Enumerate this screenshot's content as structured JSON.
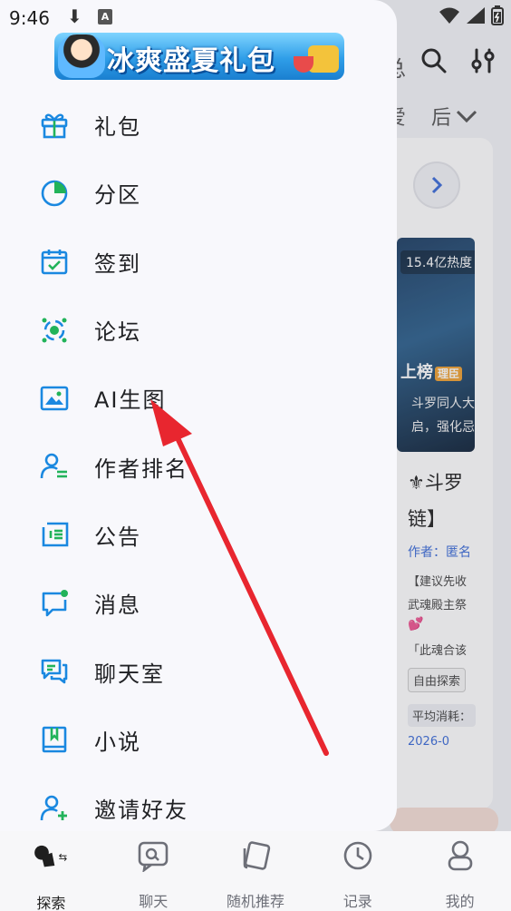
{
  "status_bar": {
    "time": "9:46",
    "download_glyph": "⬇",
    "a_glyph": "A"
  },
  "promo_banner": {
    "text": "冰爽盛夏礼包"
  },
  "drawer": {
    "items": [
      {
        "label": "礼包",
        "icon": "gift-icon"
      },
      {
        "label": "分区",
        "icon": "pie-chart-icon"
      },
      {
        "label": "签到",
        "icon": "calendar-check-icon"
      },
      {
        "label": "论坛",
        "icon": "forum-icon"
      },
      {
        "label": "AI生图",
        "icon": "image-icon"
      },
      {
        "label": "作者排名",
        "icon": "author-rank-icon"
      },
      {
        "label": "公告",
        "icon": "announcement-icon"
      },
      {
        "label": "消息",
        "icon": "message-icon"
      },
      {
        "label": "聊天室",
        "icon": "chatroom-icon"
      },
      {
        "label": "小说",
        "icon": "book-icon"
      },
      {
        "label": "邀请好友",
        "icon": "invite-friend-icon"
      }
    ]
  },
  "background": {
    "peek_char": "总",
    "tabs": [
      "爱",
      "后"
    ],
    "heat": "15.4亿热度",
    "rank_label": "上榜",
    "rank_badge": "理臣",
    "image_line1": "斗罗同人大",
    "image_line2": "启，强化忌",
    "title_line1": "⚜斗罗",
    "title_line2": "链】",
    "author": "作者：匿名",
    "line1": "【建议先收",
    "line2": "武魂殿主祭",
    "heart": "💕",
    "line3": "「此魂合该",
    "tag": "自由探索",
    "cost": "平均消耗：",
    "date": "2026-0"
  },
  "bottom_nav": {
    "items": [
      {
        "label": "探索",
        "icon": "explore-icon",
        "active": true
      },
      {
        "label": "聊天",
        "icon": "chat-icon",
        "active": false
      },
      {
        "label": "随机推荐",
        "icon": "random-card-icon",
        "active": false
      },
      {
        "label": "记录",
        "icon": "clock-icon",
        "active": false
      },
      {
        "label": "我的",
        "icon": "profile-icon",
        "active": false
      }
    ]
  },
  "colors": {
    "accent_blue": "#1a88e0",
    "accent_green": "#22b35a",
    "annotation_red": "#e8262f"
  }
}
